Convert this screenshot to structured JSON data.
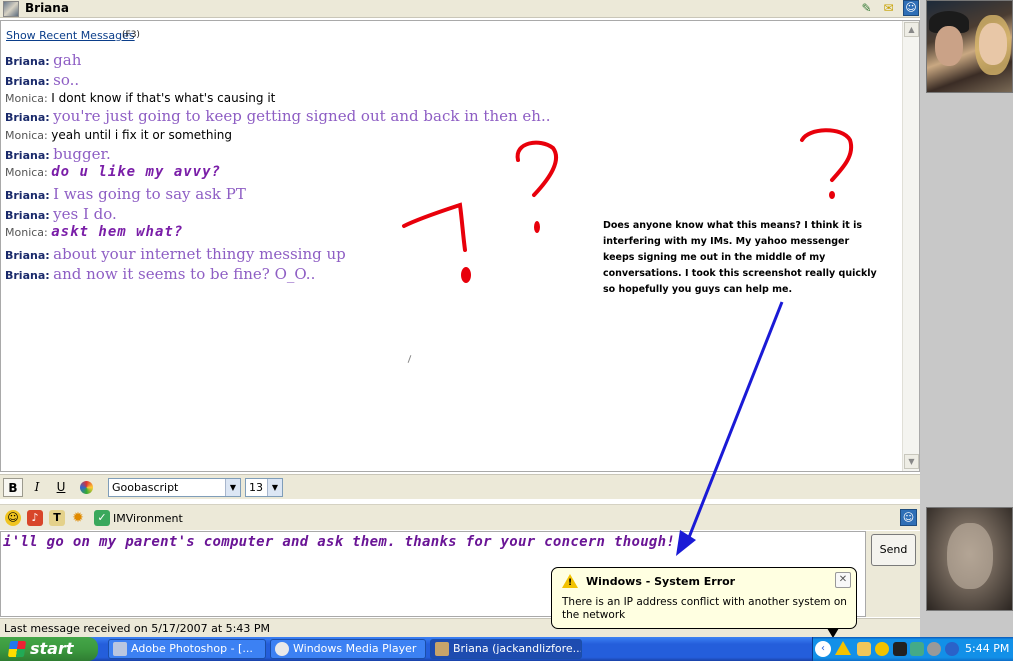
{
  "window": {
    "title": "Briana"
  },
  "history": {
    "show_recent_label": "Show Recent Messages",
    "show_recent_key": "(F3)",
    "messages": [
      {
        "sender": "Briana:",
        "text": "gah"
      },
      {
        "sender": "Briana:",
        "text": "so.."
      },
      {
        "sender": "Monica:",
        "text": "I dont know if that's what's causing it"
      },
      {
        "sender": "Briana:",
        "text": "you're just going to keep getting signed out and back in then eh.."
      },
      {
        "sender": "Monica:",
        "text": "yeah until i fix it or something"
      },
      {
        "sender": "Briana:",
        "text": "bugger."
      },
      {
        "sender": "Monica:",
        "text": "do u like my avvy?"
      },
      {
        "sender": "Briana:",
        "text": "I was going to say ask PT"
      },
      {
        "sender": "Briana:",
        "text": "yes I do."
      },
      {
        "sender": "Monica:",
        "text": "askt hem what?"
      },
      {
        "sender": "Briana:",
        "text": "about your internet thingy messing up"
      },
      {
        "sender": "Briana:",
        "text": "and now it seems to be fine? O_O.."
      }
    ]
  },
  "annotation": {
    "note_text": "Does anyone know what this means? I think it is interfering with my IMs. My yahoo messenger keeps signing me out in the middle of my conversations. I took this screenshot really quickly so hopefully you guys can help me.",
    "scribble_color": "#e8000b",
    "arrow_color": "#1a1ad6"
  },
  "format_toolbar": {
    "bold": "B",
    "italic": "I",
    "underline": "U",
    "font_name": "Goobascript",
    "font_size": "13"
  },
  "extras_toolbar": {
    "imvironment_label": "IMVironment"
  },
  "input": {
    "text": "i'll go on my parent's computer and ask them. thanks for your concern though!"
  },
  "send_label": "Send",
  "status": {
    "text": "Last message received on 5/17/2007 at 5:43 PM"
  },
  "balloon": {
    "title": "Windows - System Error",
    "body": "There is an IP address conflict with another system on the network"
  },
  "taskbar": {
    "start_label": "start",
    "tasks": [
      {
        "label": "Adobe Photoshop - [..."
      },
      {
        "label": "Windows Media Player"
      },
      {
        "label": "Briana (jackandlizfore..."
      }
    ],
    "clock": "5:44 PM"
  },
  "colors": {
    "briana_text": "#8e5ec4",
    "monica_custom_text": "#7a1ea8",
    "input_text": "#6a1596",
    "taskbar_blue": "#245edb",
    "start_green": "#3c9a3f",
    "balloon_bg": "#ffffe1"
  }
}
